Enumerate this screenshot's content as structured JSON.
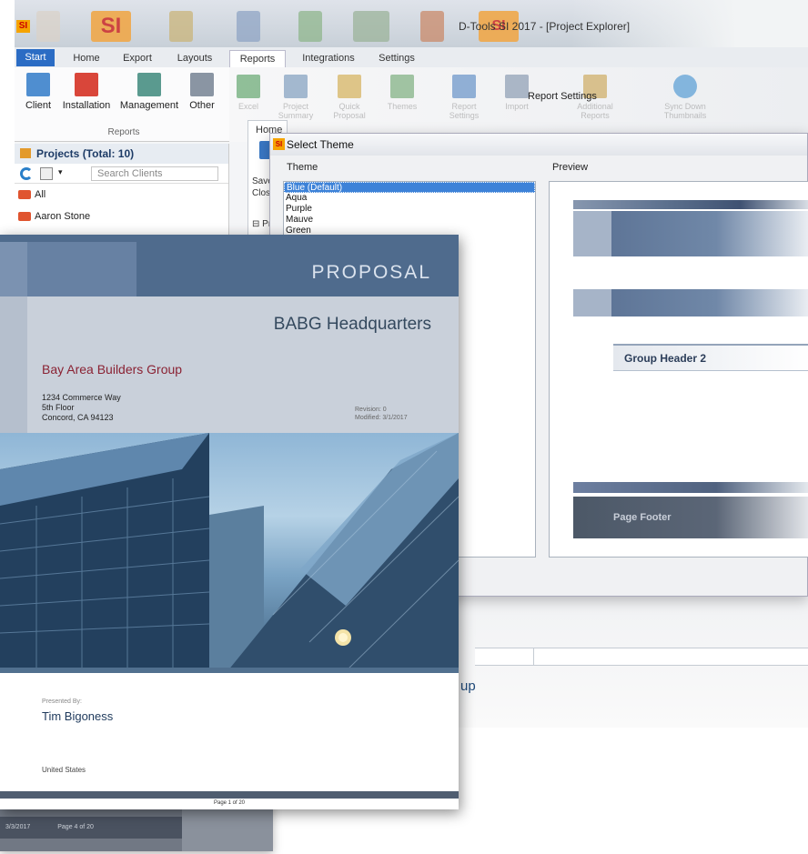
{
  "window": {
    "title": "D-Tools SI 2017 - [Project Explorer]"
  },
  "tabs": [
    "Start",
    "Home",
    "Export",
    "Layouts",
    "Reports",
    "Integrations",
    "Settings"
  ],
  "active_tab": "Reports",
  "ribbon": {
    "buttons": [
      "Client",
      "Installation",
      "Management",
      "Other"
    ],
    "group": "Reports",
    "secondary_buttons": [
      "Excel",
      "Project Summary",
      "Quick Proposal",
      "Themes",
      "Report Settings",
      "Import",
      "Additional Reports",
      "Sync Down Thumbnails"
    ],
    "report_settings_label": "Report Settings"
  },
  "projects": {
    "header": "Projects (Total: 10)",
    "search_placeholder": "Search Clients",
    "items": [
      "All",
      "Aaron Stone"
    ]
  },
  "home_panel": {
    "label": "Home",
    "save_line1": "Save a",
    "save_line2": "Close",
    "node": "Pro"
  },
  "dialog": {
    "title": "Select Theme",
    "theme_label": "Theme",
    "preview_label": "Preview",
    "themes": [
      "Blue (Default)",
      "Aqua",
      "Purple",
      "Mauve",
      "Green"
    ],
    "selected": "Blue (Default)",
    "preview": {
      "group_header": "Group Header 2",
      "page_footer": "Page Footer"
    }
  },
  "background_text": "up",
  "proposal": {
    "heading": "PROPOSAL",
    "project": "BABG Headquarters",
    "company": "Bay Area Builders Group",
    "address": [
      "1234 Commerce Way",
      "5th Floor",
      "Concord, CA 94123"
    ],
    "revision": "Revision: 0",
    "modified": "Modified: 3/1/2017",
    "presented_by_label": "Presented By:",
    "presenter": "Tim Bigoness",
    "country": "United States",
    "page": "Page 1 of 20"
  },
  "back_page": {
    "date": "3/3/2017",
    "page": "Page 4 of 20"
  },
  "colors": {
    "accent": "#2b6cc4",
    "page_header": "#4f6b8d",
    "company": "#8a2233"
  }
}
